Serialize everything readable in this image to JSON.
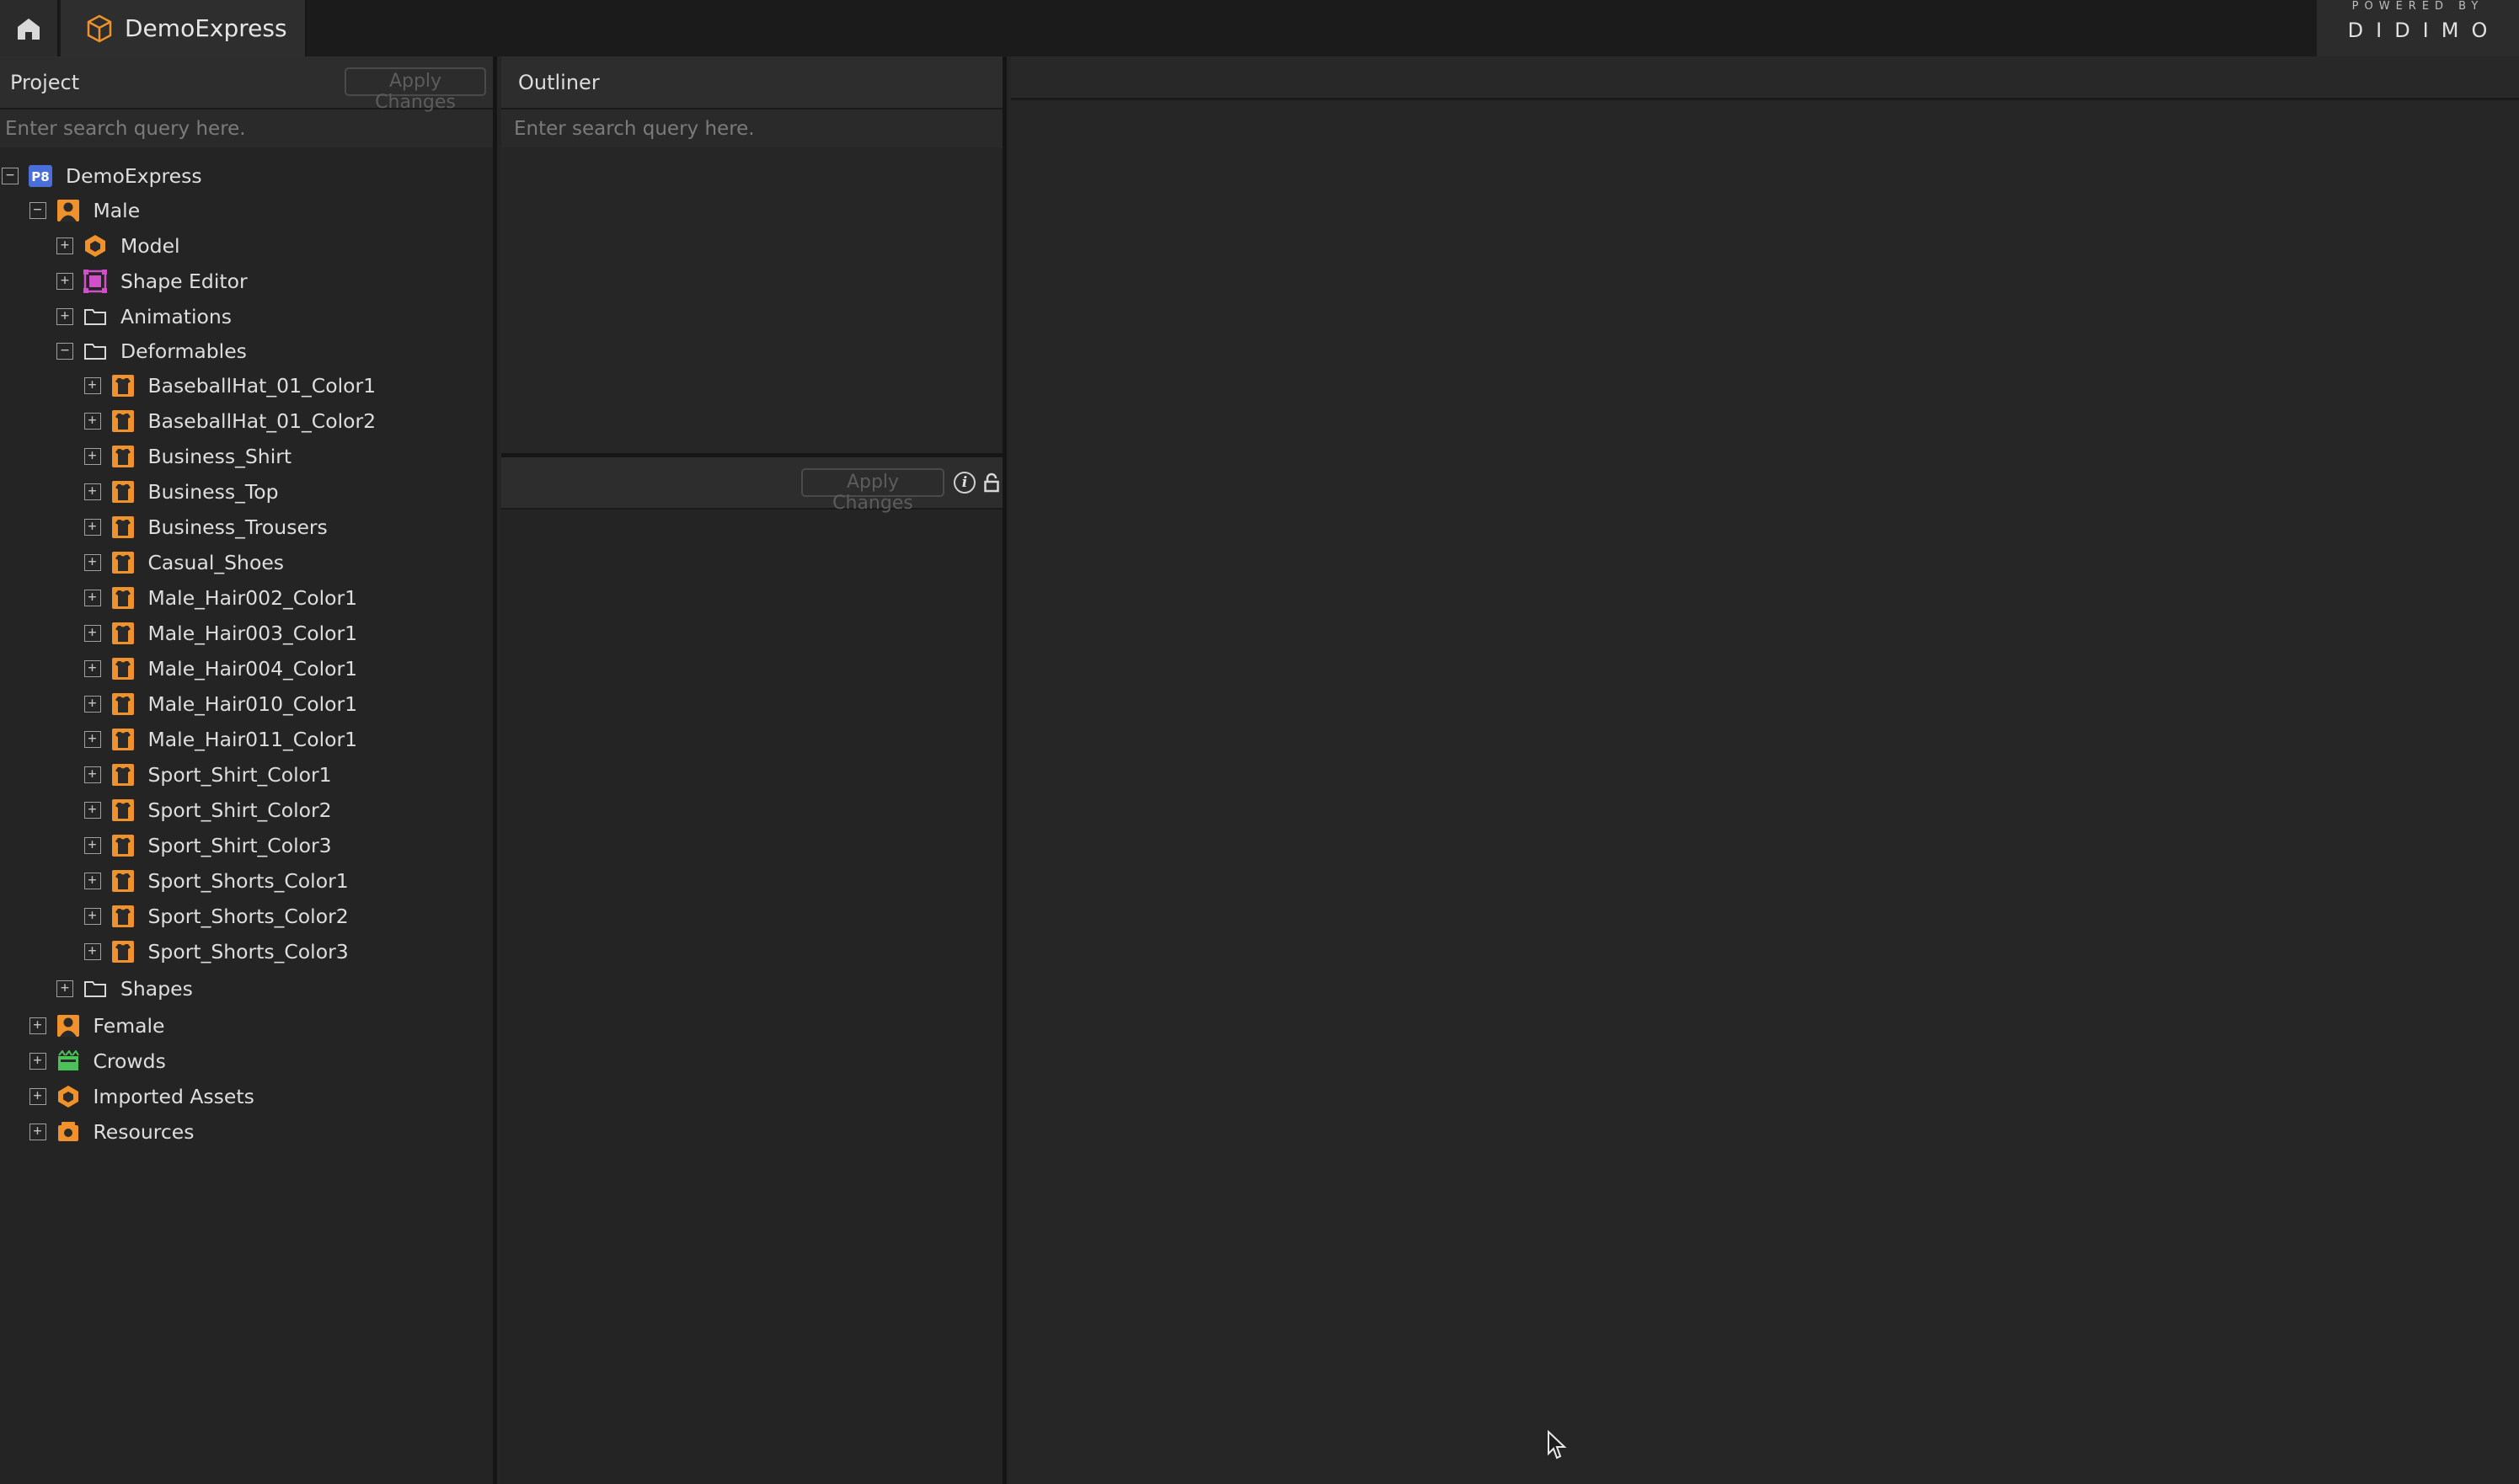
{
  "titlebar": {
    "app_tab": "DemoExpress",
    "brand_powered": "POWERED BY",
    "brand_logo": "DIDIMO"
  },
  "project": {
    "title": "Project",
    "apply_label": "Apply Changes",
    "search_placeholder": "Enter search query here.",
    "tree": [
      {
        "label": "DemoExpress",
        "icon": "project-icon",
        "depth": 0,
        "toggle": "−"
      },
      {
        "label": "Male",
        "icon": "person-icon",
        "depth": 1,
        "toggle": "−"
      },
      {
        "label": "Model",
        "icon": "model-icon",
        "depth": 2,
        "toggle": "+"
      },
      {
        "label": "Shape Editor",
        "icon": "shape-editor-icon",
        "depth": 2,
        "toggle": "+"
      },
      {
        "label": "Animations",
        "icon": "folder-icon",
        "depth": 2,
        "toggle": "+"
      },
      {
        "label": "Deformables",
        "icon": "folder-icon",
        "depth": 2,
        "toggle": "−"
      },
      {
        "label": "BaseballHat_01_Color1",
        "icon": "garment-icon",
        "depth": 3,
        "toggle": "+"
      },
      {
        "label": "BaseballHat_01_Color2",
        "icon": "garment-icon",
        "depth": 3,
        "toggle": "+"
      },
      {
        "label": "Business_Shirt",
        "icon": "garment-icon",
        "depth": 3,
        "toggle": "+"
      },
      {
        "label": "Business_Top",
        "icon": "garment-icon",
        "depth": 3,
        "toggle": "+"
      },
      {
        "label": "Business_Trousers",
        "icon": "garment-icon",
        "depth": 3,
        "toggle": "+"
      },
      {
        "label": "Casual_Shoes",
        "icon": "garment-icon",
        "depth": 3,
        "toggle": "+"
      },
      {
        "label": "Male_Hair002_Color1",
        "icon": "garment-icon",
        "depth": 3,
        "toggle": "+"
      },
      {
        "label": "Male_Hair003_Color1",
        "icon": "garment-icon",
        "depth": 3,
        "toggle": "+"
      },
      {
        "label": "Male_Hair004_Color1",
        "icon": "garment-icon",
        "depth": 3,
        "toggle": "+"
      },
      {
        "label": "Male_Hair010_Color1",
        "icon": "garment-icon",
        "depth": 3,
        "toggle": "+"
      },
      {
        "label": "Male_Hair011_Color1",
        "icon": "garment-icon",
        "depth": 3,
        "toggle": "+"
      },
      {
        "label": "Sport_Shirt_Color1",
        "icon": "garment-icon",
        "depth": 3,
        "toggle": "+"
      },
      {
        "label": "Sport_Shirt_Color2",
        "icon": "garment-icon",
        "depth": 3,
        "toggle": "+"
      },
      {
        "label": "Sport_Shirt_Color3",
        "icon": "garment-icon",
        "depth": 3,
        "toggle": "+"
      },
      {
        "label": "Sport_Shorts_Color1",
        "icon": "garment-icon",
        "depth": 3,
        "toggle": "+"
      },
      {
        "label": "Sport_Shorts_Color2",
        "icon": "garment-icon",
        "depth": 3,
        "toggle": "+"
      },
      {
        "label": "Sport_Shorts_Color3",
        "icon": "garment-icon",
        "depth": 3,
        "toggle": "+"
      },
      {
        "label": "Shapes",
        "icon": "folder-icon",
        "depth": 2,
        "toggle": "+"
      },
      {
        "label": "Female",
        "icon": "person-icon",
        "depth": 1,
        "toggle": "+"
      },
      {
        "label": "Crowds",
        "icon": "crowds-icon",
        "depth": 1,
        "toggle": "+"
      },
      {
        "label": "Imported Assets",
        "icon": "model-icon",
        "depth": 1,
        "toggle": "+"
      },
      {
        "label": "Resources",
        "icon": "resources-icon",
        "depth": 1,
        "toggle": "+"
      }
    ]
  },
  "outliner": {
    "title": "Outliner",
    "search_placeholder": "Enter search query here.",
    "apply_label": "Apply Changes"
  },
  "colors": {
    "accent_orange": "#f0922b",
    "project_blue": "#4a6fd8",
    "shape_pink": "#d14fc9",
    "crowds_green": "#4cc15a"
  }
}
